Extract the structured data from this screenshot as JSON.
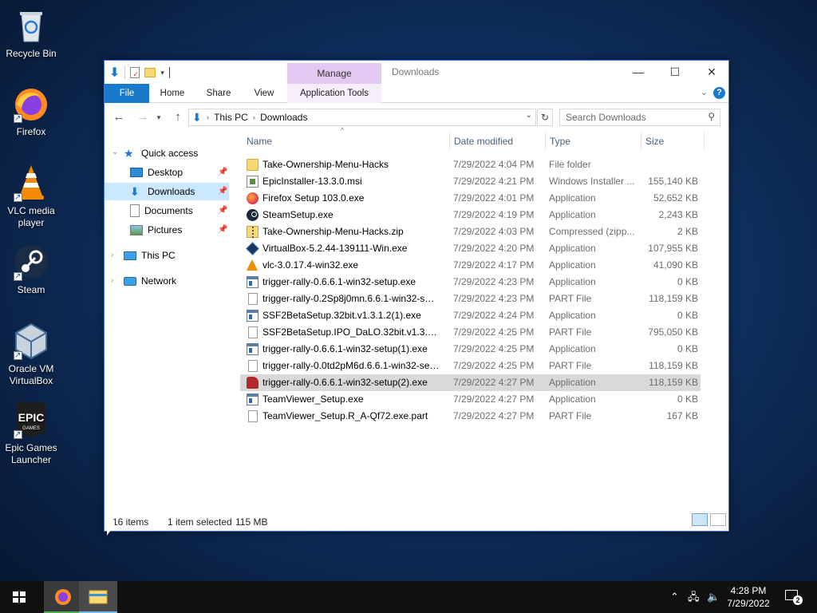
{
  "desktop": {
    "icons": [
      {
        "label": "Recycle Bin",
        "icon": "recycle-bin-icon"
      },
      {
        "label": "Firefox",
        "icon": "firefox-icon"
      },
      {
        "label": "VLC media player",
        "icon": "vlc-icon"
      },
      {
        "label": "Steam",
        "icon": "steam-icon"
      },
      {
        "label": "Oracle VM VirtualBox",
        "icon": "virtualbox-icon"
      },
      {
        "label": "Epic Games Launcher",
        "icon": "epic-games-icon"
      }
    ]
  },
  "window": {
    "title": "Downloads",
    "contextual_tab_group": "Manage",
    "ribbon_tabs": [
      "File",
      "Home",
      "Share",
      "View",
      "Application Tools"
    ],
    "address": {
      "segments": [
        "This PC",
        "Downloads"
      ]
    },
    "search": {
      "placeholder": "Search Downloads"
    },
    "nav": {
      "quick_access": "Quick access",
      "items": [
        "Desktop",
        "Downloads",
        "Documents",
        "Pictures"
      ],
      "this_pc": "This PC",
      "network": "Network"
    },
    "columns": [
      "Name",
      "Date modified",
      "Type",
      "Size"
    ],
    "files": [
      {
        "name": "Take-Ownership-Menu-Hacks",
        "date": "7/29/2022 4:04 PM",
        "type": "File folder",
        "size": "",
        "icon": "folder"
      },
      {
        "name": "EpicInstaller-13.3.0.msi",
        "date": "7/29/2022 4:21 PM",
        "type": "Windows Installer ...",
        "size": "155,140 KB",
        "icon": "msi"
      },
      {
        "name": "Firefox Setup 103.0.exe",
        "date": "7/29/2022 4:01 PM",
        "type": "Application",
        "size": "52,652 KB",
        "icon": "fox"
      },
      {
        "name": "SteamSetup.exe",
        "date": "7/29/2022 4:19 PM",
        "type": "Application",
        "size": "2,243 KB",
        "icon": "steam"
      },
      {
        "name": "Take-Ownership-Menu-Hacks.zip",
        "date": "7/29/2022 4:03 PM",
        "type": "Compressed (zipp...",
        "size": "2 KB",
        "icon": "zip"
      },
      {
        "name": "VirtualBox-5.2.44-139111-Win.exe",
        "date": "7/29/2022 4:20 PM",
        "type": "Application",
        "size": "107,955 KB",
        "icon": "vbox"
      },
      {
        "name": "vlc-3.0.17.4-win32.exe",
        "date": "7/29/2022 4:17 PM",
        "type": "Application",
        "size": "41,090 KB",
        "icon": "vlc"
      },
      {
        "name": "trigger-rally-0.6.6.1-win32-setup.exe",
        "date": "7/29/2022 4:23 PM",
        "type": "Application",
        "size": "0 KB",
        "icon": "exe"
      },
      {
        "name": "trigger-rally-0.2Sp8j0mn.6.6.1-win32-set...",
        "date": "7/29/2022 4:23 PM",
        "type": "PART File",
        "size": "118,159 KB",
        "icon": "part"
      },
      {
        "name": "SSF2BetaSetup.32bit.v1.3.1.2(1).exe",
        "date": "7/29/2022 4:24 PM",
        "type": "Application",
        "size": "0 KB",
        "icon": "exe"
      },
      {
        "name": "SSF2BetaSetup.IPO_DaLO.32bit.v1.3.1.2(1...",
        "date": "7/29/2022 4:25 PM",
        "type": "PART File",
        "size": "795,050 KB",
        "icon": "part"
      },
      {
        "name": "trigger-rally-0.6.6.1-win32-setup(1).exe",
        "date": "7/29/2022 4:25 PM",
        "type": "Application",
        "size": "0 KB",
        "icon": "exe"
      },
      {
        "name": "trigger-rally-0.0td2pM6d.6.6.1-win32-set...",
        "date": "7/29/2022 4:25 PM",
        "type": "PART File",
        "size": "118,159 KB",
        "icon": "part"
      },
      {
        "name": "trigger-rally-0.6.6.1-win32-setup(2).exe",
        "date": "7/29/2022 4:27 PM",
        "type": "Application",
        "size": "118,159 KB",
        "icon": "car",
        "selected": true
      },
      {
        "name": "TeamViewer_Setup.exe",
        "date": "7/29/2022 4:27 PM",
        "type": "Application",
        "size": "0 KB",
        "icon": "exe"
      },
      {
        "name": "TeamViewer_Setup.R_A-Qf72.exe.part",
        "date": "7/29/2022 4:27 PM",
        "type": "PART File",
        "size": "167 KB",
        "icon": "part"
      }
    ],
    "status": {
      "items": "16 items",
      "selected": "1 item selected",
      "size": "115 MB"
    }
  },
  "taskbar": {
    "clock_time": "4:28 PM",
    "clock_date": "7/29/2022",
    "notification_count": "2"
  }
}
